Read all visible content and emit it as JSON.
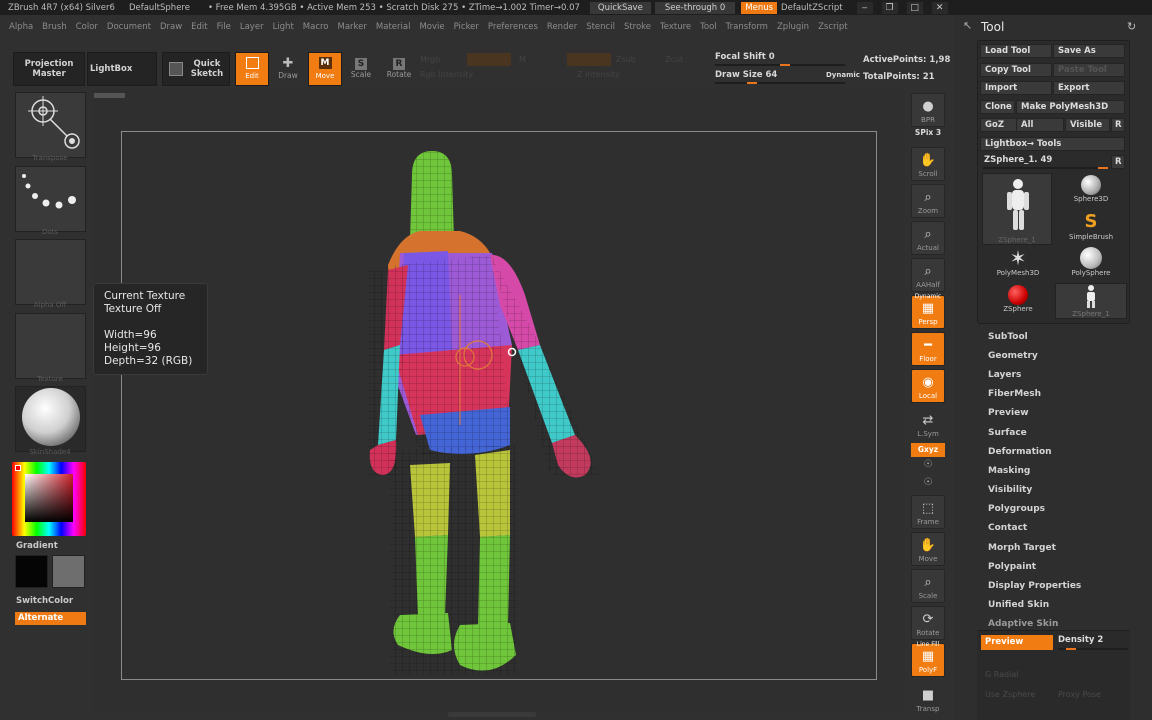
{
  "titlebar": {
    "app": "ZBrush 4R7 (x64) Silver6",
    "document": "DefaultSphere",
    "free_mem": "• Free Mem 4.395GB • Active Mem 253 • Scratch Disk 275 • ZTime→1.002 Timer→0.07",
    "quicksave": "QuickSave",
    "see_through": "See-through  0",
    "menus": "Menus",
    "script": "DefaultZScript"
  },
  "menu": [
    "Alpha",
    "Brush",
    "Color",
    "Document",
    "Draw",
    "Edit",
    "File",
    "Layer",
    "Light",
    "Macro",
    "Marker",
    "Material",
    "Movie",
    "Picker",
    "Preferences",
    "Render",
    "Stencil",
    "Stroke",
    "Texture",
    "Tool",
    "Transform",
    "Zplugin",
    "Zscript"
  ],
  "toolbar": {
    "projection_master": "Projection Master",
    "lightbox": "LightBox",
    "quick_sketch": "Quick Sketch",
    "edit": "Edit",
    "draw": "Draw",
    "move": "Move",
    "scale": "Scale",
    "rotate": "Rotate",
    "mrgb": "Mrgb",
    "rgb": "Rgb",
    "m": "M",
    "zadd": "Zadd",
    "zsub": "Zsub",
    "zcut": "Zcut",
    "rgb_intensity": "Rgb Intensity",
    "z_intensity": "Z Intensity",
    "focal_shift": "Focal Shift 0",
    "draw_size": "Draw Size 64",
    "dynamic": "Dynamic",
    "active_points": "ActivePoints: 1,98",
    "total_points": "TotalPoints: 21"
  },
  "left_shelf": {
    "transpose": "Transpose",
    "dots": "Dots",
    "alpha_off": "Alpha Off",
    "texture": "Texture",
    "material": "SkinShade4",
    "gradient": "Gradient",
    "switch_color": "SwitchColor",
    "alternate": "Alternate"
  },
  "tooltip": {
    "title": "Current Texture",
    "state": "Texture Off",
    "width": "Width=96",
    "height": "Height=96",
    "depth": "Depth=32 (RGB)"
  },
  "right_shelf": {
    "bpr": "BPR",
    "spix": "SPix 3",
    "scroll": "Scroll",
    "zoom": "Zoom",
    "actual": "Actual",
    "aahalf": "AAHalf",
    "dynamic": "Dynamic",
    "persp": "Persp",
    "floor": "Floor",
    "local": "Local",
    "lsym": "L.Sym",
    "gxyz": "Gxyz",
    "frame": "Frame",
    "move": "Move",
    "scale": "Scale",
    "rotate": "Rotate",
    "line_fill": "Line Fill",
    "polyf": "PolyF",
    "transp": "Transp"
  },
  "tool_panel": {
    "title": "Tool",
    "load_tool": "Load Tool",
    "save_as": "Save As",
    "copy_tool": "Copy Tool",
    "paste_tool": "Paste Tool",
    "import": "Import",
    "export": "Export",
    "clone": "Clone",
    "make_polymesh": "Make PolyMesh3D",
    "goz": "GoZ",
    "all": "All",
    "visible": "Visible",
    "r": "R",
    "lightbox_tools": "Lightbox→ Tools",
    "current_tool": "ZSphere_1. 49",
    "tools": [
      {
        "name": "ZSphere_1",
        "icon": "zsphere-figure-icon"
      },
      {
        "name": "Sphere3D",
        "icon": "sphere-icon"
      },
      {
        "name": "SimpleBrush",
        "icon": "simplebrush-icon"
      },
      {
        "name": "PolyMesh3D",
        "icon": "star-icon"
      },
      {
        "name": "PolySphere",
        "icon": "sphere-icon"
      },
      {
        "name": "ZSphere",
        "icon": "zsphere-icon"
      },
      {
        "name": "ZSphere_1",
        "icon": "zsphere-figure-icon"
      }
    ],
    "sections": [
      "SubTool",
      "Geometry",
      "Layers",
      "FiberMesh",
      "Preview",
      "Surface",
      "Deformation",
      "Masking",
      "Visibility",
      "Polygroups",
      "Contact",
      "Morph Target",
      "Polypaint",
      "Display Properties",
      "Unified Skin",
      "Adaptive Skin"
    ],
    "preview": "Preview",
    "density": "Density 2",
    "g_radial": "G Radial",
    "use_zsphere": "Use Zsphere",
    "proxy_pose": "Proxy Pose"
  },
  "colors": {
    "accent": "#f07c12",
    "panel": "#2e2e2e",
    "button": "#3a3a3a"
  }
}
